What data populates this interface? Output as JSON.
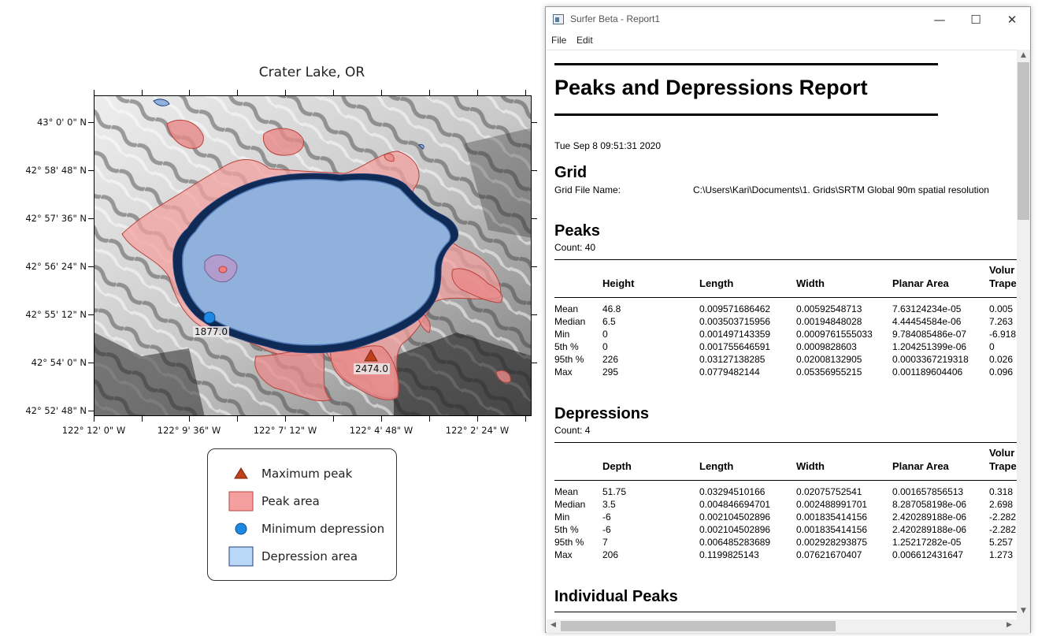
{
  "map": {
    "title": "Crater Lake, OR",
    "lat_labels": [
      "43° 0' 0\" N",
      "42° 58' 48\" N",
      "42° 57' 36\" N",
      "42° 56' 24\" N",
      "42° 55' 12\" N",
      "42° 54' 0\" N",
      "42° 52' 48\" N"
    ],
    "lon_labels": [
      "122° 12' 0\" W",
      "122° 9' 36\" W",
      "122° 7' 12\" W",
      "122° 4' 48\" W",
      "122° 2' 24\" W"
    ],
    "min_label": "1877.0",
    "max_label": "2474.0",
    "colors": {
      "peak_fill": "#f4a0a0",
      "peak_stroke": "#b8423c",
      "depression_fill": "#8fb1dc",
      "depression_stroke": "#1f3f7a",
      "max_marker": "#c0401a",
      "min_marker": "#1e88e5"
    }
  },
  "legend": {
    "items": [
      {
        "label": "Maximum peak",
        "icon": "triangle-icon"
      },
      {
        "label": "Peak area",
        "icon": "swatch-icon"
      },
      {
        "label": "Minimum depression",
        "icon": "circle-icon"
      },
      {
        "label": "Depression area",
        "icon": "swatch-icon"
      }
    ]
  },
  "window": {
    "title": "Surfer Beta - Report1",
    "menu": [
      "File",
      "Edit"
    ],
    "buttons": {
      "minimize": "—",
      "maximize": "☐",
      "close": "✕"
    }
  },
  "report": {
    "title": "Peaks and Depressions Report",
    "date": "Tue Sep  8 09:51:31 2020",
    "grid": {
      "heading": "Grid",
      "label": "Grid File Name:",
      "value": "C:\\Users\\Kari\\Documents\\1. Grids\\SRTM Global 90m spatial resolution"
    },
    "peaks": {
      "heading": "Peaks",
      "count": "Count: 40",
      "headers": [
        "Height",
        "Length",
        "Width",
        "Planar Area",
        "Volur",
        "Trape"
      ],
      "rows": [
        [
          "Mean",
          "46.8",
          "0.009571686462",
          "0.00592548713",
          "7.63124234e-05",
          "0.005"
        ],
        [
          "Median",
          "6.5",
          "0.003503715956",
          "0.00194848028",
          "4.44454584e-06",
          "7.263"
        ],
        [
          "Min",
          "0",
          "0.001497143359",
          "0.0009761555033",
          "9.784085486e-07",
          "-6.918"
        ],
        [
          "5th %",
          "0",
          "0.001755646591",
          "0.0009828603",
          "1.204251399e-06",
          "0"
        ],
        [
          "95th %",
          "226",
          "0.03127138285",
          "0.02008132905",
          "0.0003367219318",
          "0.026"
        ],
        [
          "Max",
          "295",
          "0.0779482144",
          "0.05356955215",
          "0.001189604406",
          "0.096"
        ]
      ]
    },
    "depressions": {
      "heading": "Depressions",
      "count": "Count: 4",
      "headers": [
        "Depth",
        "Length",
        "Width",
        "Planar Area",
        "Volur",
        "Trape"
      ],
      "rows": [
        [
          "Mean",
          "51.75",
          "0.03294510166",
          "0.02075752541",
          "0.001657856513",
          "0.318"
        ],
        [
          "Median",
          "3.5",
          "0.004846694701",
          "0.002488991701",
          "8.287058198e-06",
          "2.698"
        ],
        [
          "Min",
          "-6",
          "0.002104502896",
          "0.001835414156",
          "2.420289188e-06",
          "-2.282"
        ],
        [
          "5th %",
          "-6",
          "0.002104502896",
          "0.001835414156",
          "2.420289188e-06",
          "-2.282"
        ],
        [
          "95th %",
          "7",
          "0.006485283689",
          "0.002928293875",
          "1.25217282e-05",
          "5.257"
        ],
        [
          "Max",
          "206",
          "0.1199825143",
          "0.07621670407",
          "0.006612431647",
          "1.273"
        ]
      ]
    },
    "individual_heading": "Individual Peaks"
  }
}
